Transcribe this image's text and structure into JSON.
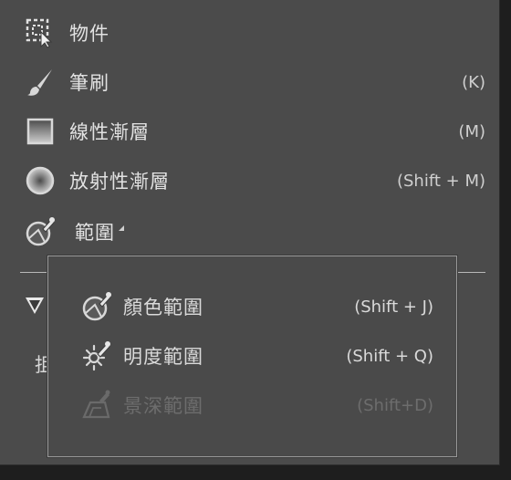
{
  "menu": {
    "items": [
      {
        "label": "物件",
        "shortcut": "",
        "icon": "object-select-icon"
      },
      {
        "label": "筆刷",
        "shortcut": "(K)",
        "icon": "brush-icon"
      },
      {
        "label": "線性漸層",
        "shortcut": "(M)",
        "icon": "linear-gradient-icon"
      },
      {
        "label": "放射性漸層",
        "shortcut": "(Shift + M)",
        "icon": "radial-gradient-icon"
      },
      {
        "label": "範圍",
        "shortcut": "",
        "icon": "range-mask-icon",
        "has_submenu": true
      }
    ]
  },
  "background": {
    "partial_label": "抯"
  },
  "submenu": {
    "items": [
      {
        "label": "顏色範圍",
        "shortcut": "(Shift + J)",
        "icon": "color-range-icon",
        "enabled": true
      },
      {
        "label": "明度範圍",
        "shortcut": "(Shift + Q)",
        "icon": "luminance-range-icon",
        "enabled": true
      },
      {
        "label": "景深範圍",
        "shortcut": "(Shift+D)",
        "icon": "depth-range-icon",
        "enabled": false
      }
    ]
  }
}
